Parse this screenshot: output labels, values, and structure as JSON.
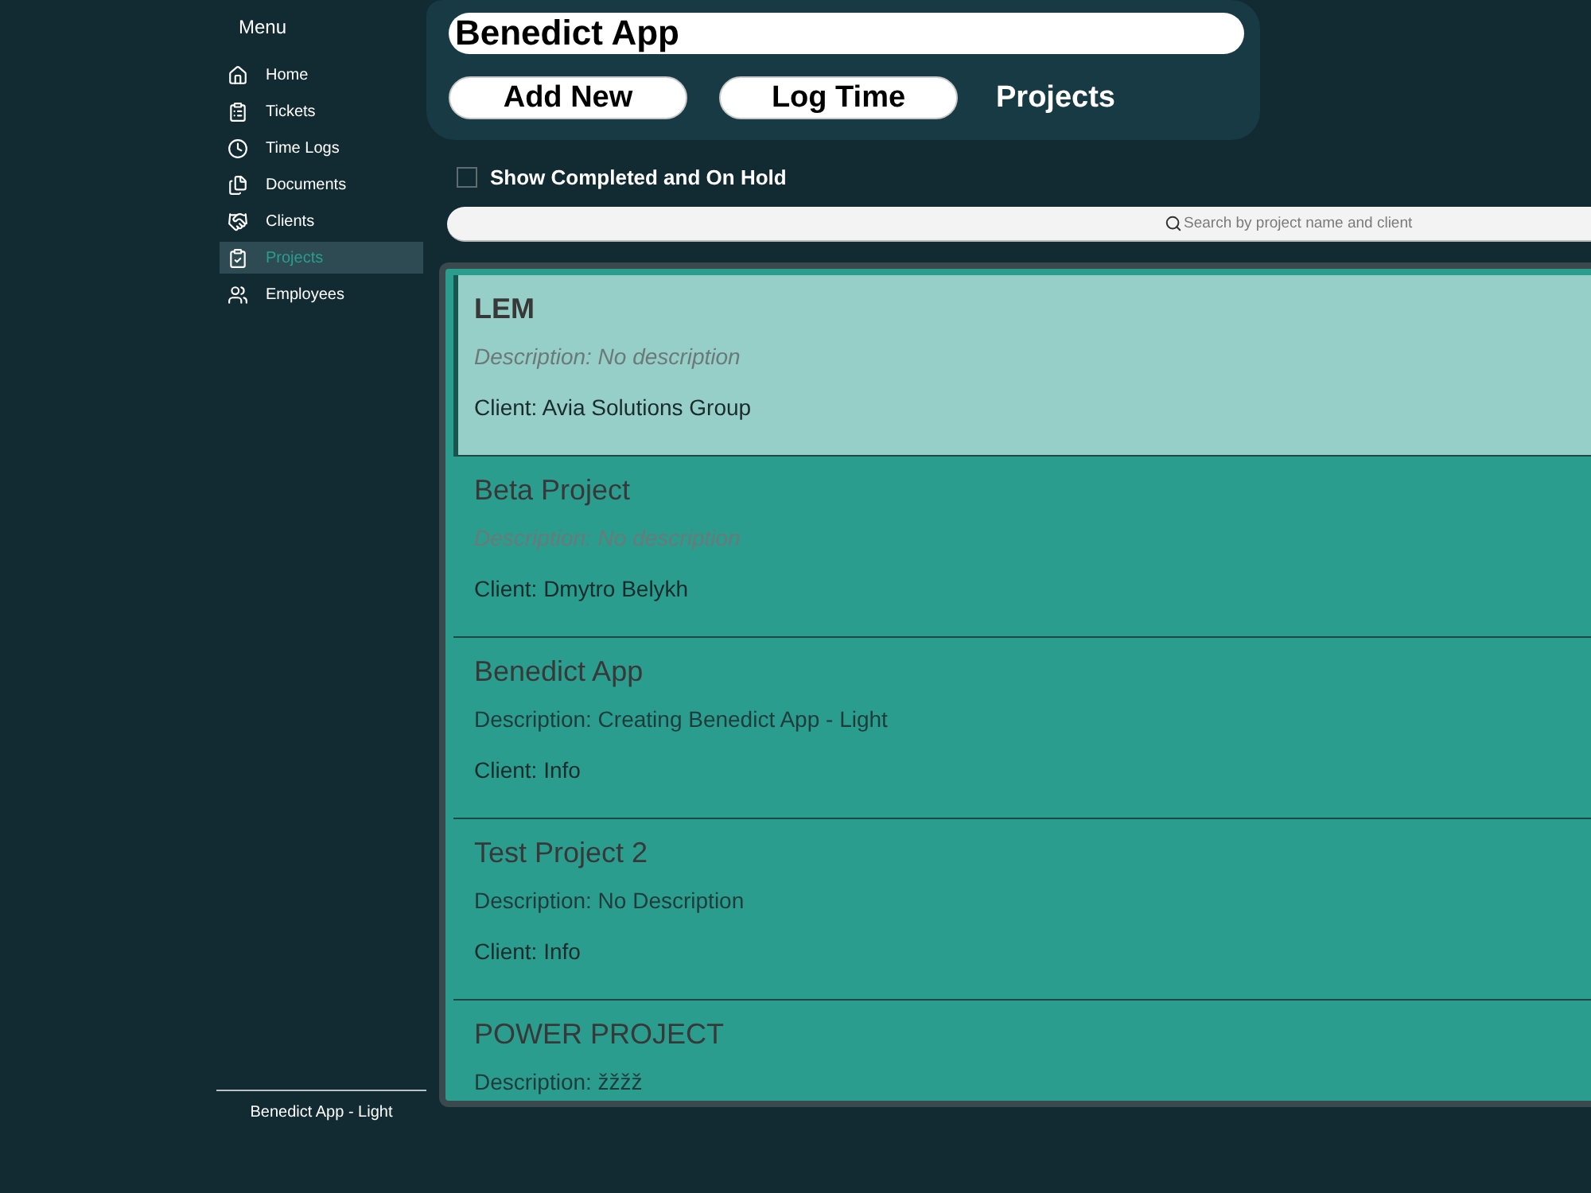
{
  "sidebar": {
    "heading": "Menu",
    "items": [
      {
        "label": "Home",
        "selected": false
      },
      {
        "label": "Tickets",
        "selected": false
      },
      {
        "label": "Time Logs",
        "selected": false
      },
      {
        "label": "Documents",
        "selected": false
      },
      {
        "label": "Clients",
        "selected": false
      },
      {
        "label": "Projects",
        "selected": true
      },
      {
        "label": "Employees",
        "selected": false
      }
    ],
    "footer": "Benedict App - Light"
  },
  "header": {
    "app_title": "Benedict App",
    "buttons": [
      "Add New",
      "Log Time"
    ],
    "page_label": "Projects"
  },
  "filter": {
    "label": "Show Completed and On Hold",
    "checked": false
  },
  "search": {
    "placeholder": "Search by project name and client"
  },
  "projects": [
    {
      "name": "LEM",
      "description": "Description: No description",
      "description_placeholder": true,
      "client": "Client: Avia Solutions Group",
      "selected": true
    },
    {
      "name": "Beta Project",
      "description": "Description: No description",
      "description_placeholder": true,
      "client": "Client: Dmytro Belykh",
      "selected": false
    },
    {
      "name": "Benedict App",
      "description": "Description: Creating Benedict App - Light",
      "description_placeholder": false,
      "client": "Client: Info",
      "selected": false
    },
    {
      "name": "Test Project 2",
      "description": "Description: No Description",
      "description_placeholder": false,
      "client": "Client: Info",
      "selected": false
    },
    {
      "name": "POWER PROJECT",
      "description": "Description: žžžž",
      "description_placeholder": false,
      "selected": false
    }
  ]
}
